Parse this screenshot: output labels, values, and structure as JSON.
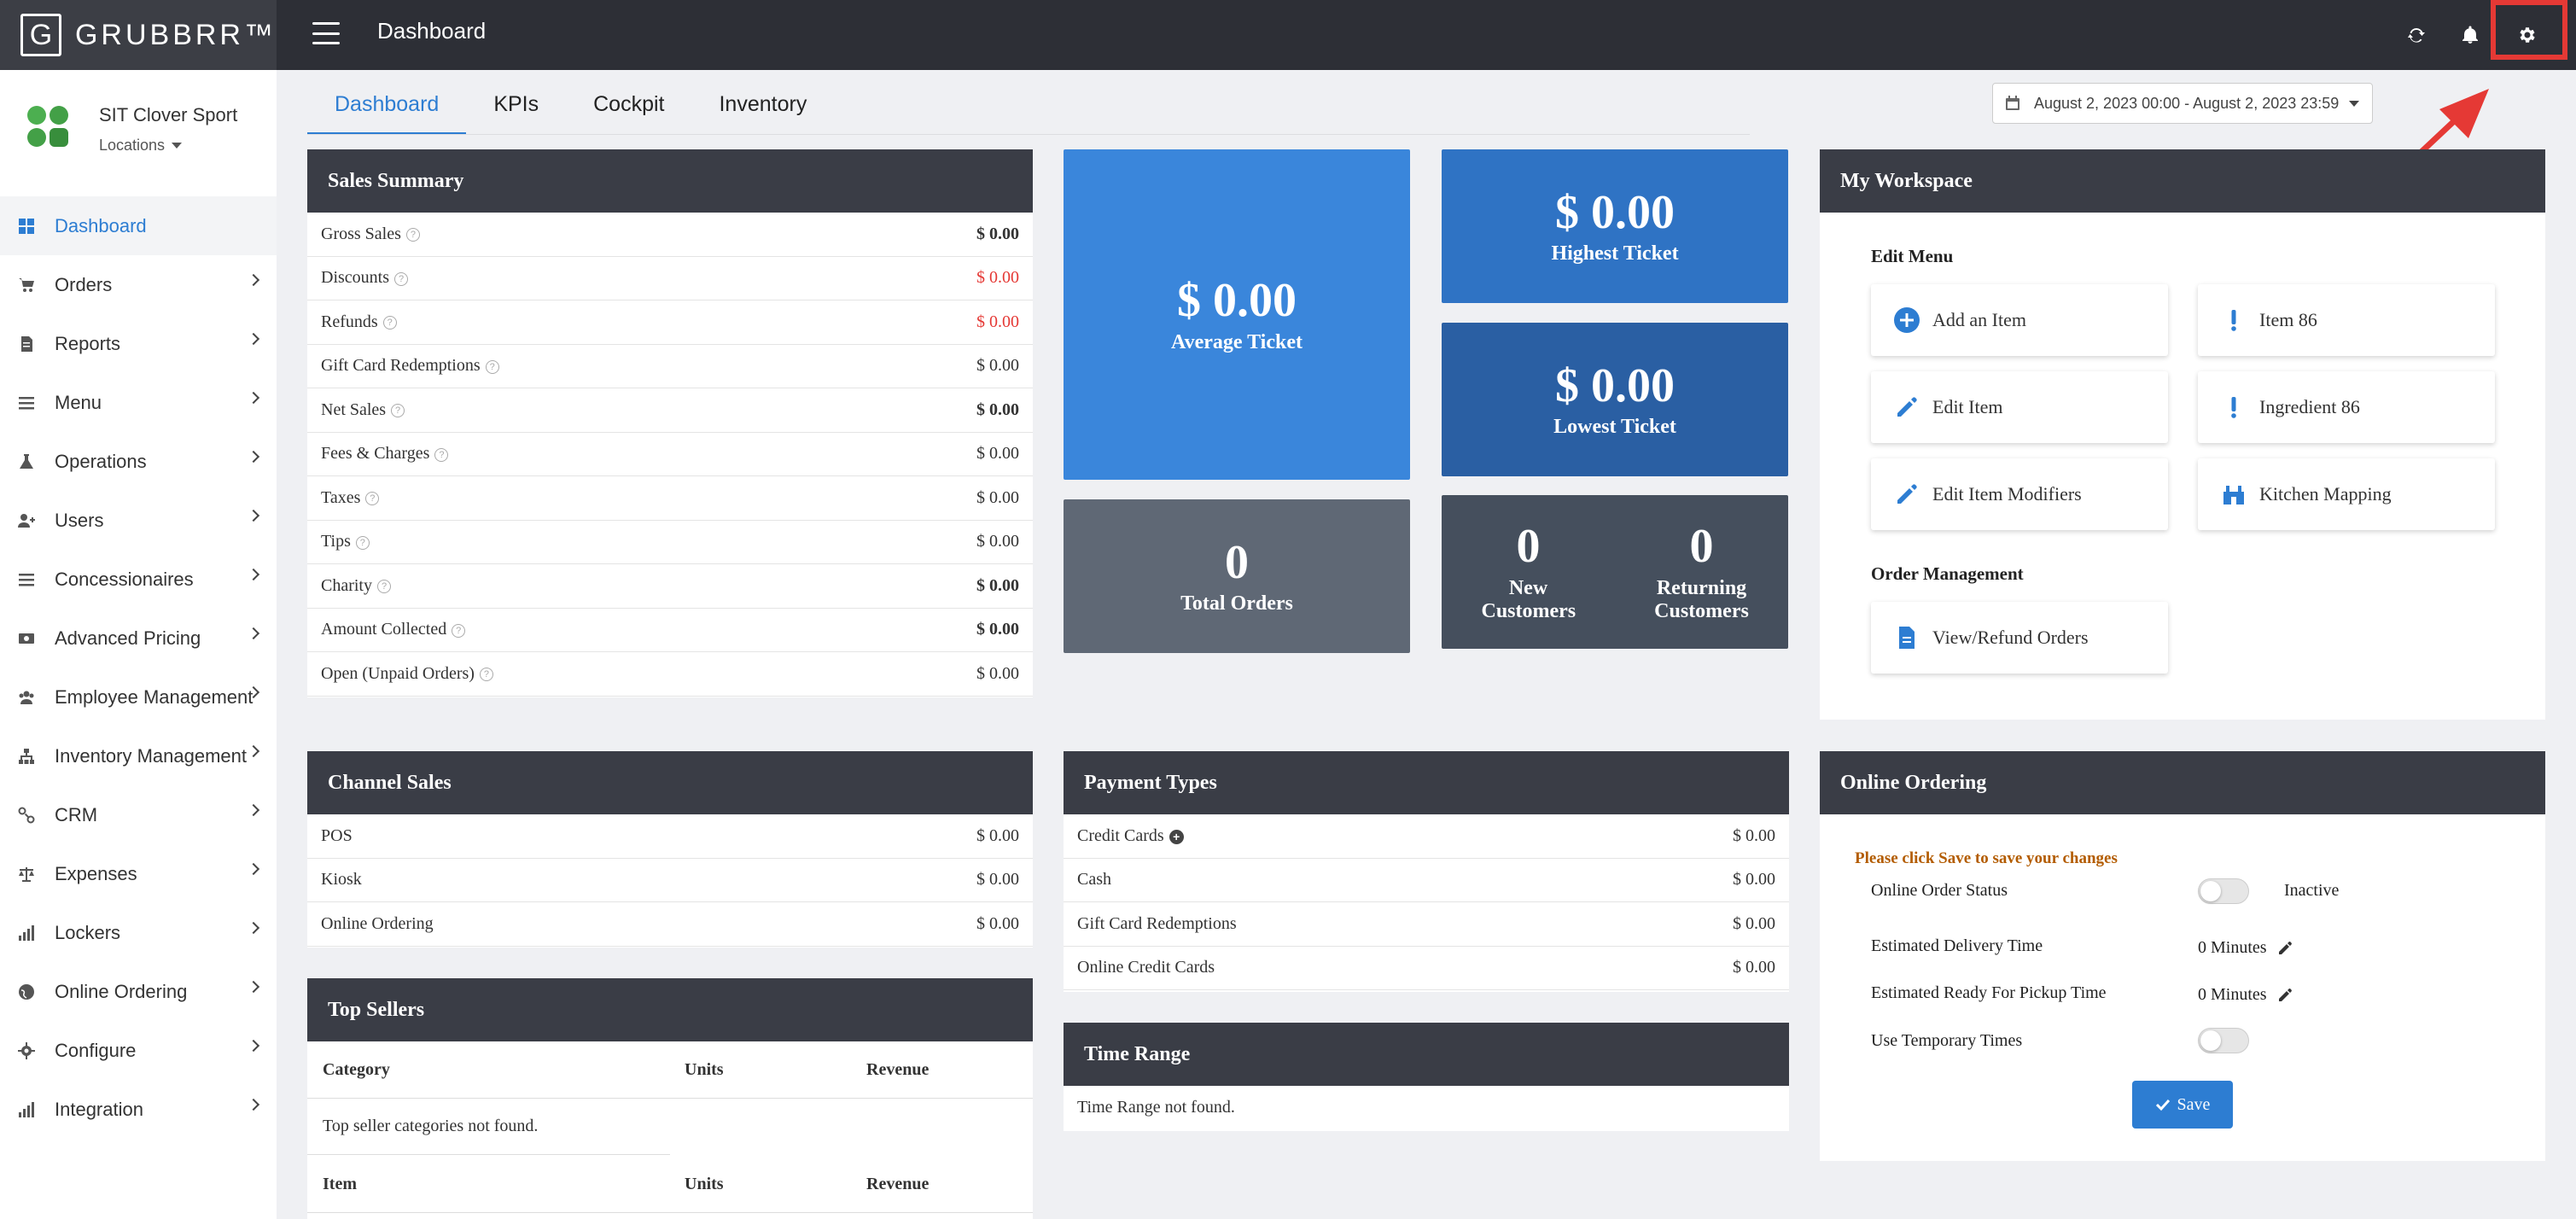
{
  "app": {
    "logo_letter": "G",
    "logo_text": "GRUBBRR™",
    "page_title": "Dashboard"
  },
  "topbar": {
    "icons": [
      "refresh-icon",
      "bell-icon",
      "gear-icon"
    ]
  },
  "store": {
    "name": "SIT Clover Sport",
    "locations_label": "Locations"
  },
  "sidebar": {
    "items": [
      {
        "label": "Dashboard",
        "icon": "dashboard-icon",
        "active": true
      },
      {
        "label": "Orders",
        "icon": "cart-icon"
      },
      {
        "label": "Reports",
        "icon": "report-icon"
      },
      {
        "label": "Menu",
        "icon": "menu-icon"
      },
      {
        "label": "Operations",
        "icon": "flask-icon"
      },
      {
        "label": "Users",
        "icon": "users-icon"
      },
      {
        "label": "Concessionaires",
        "icon": "list-icon"
      },
      {
        "label": "Advanced Pricing",
        "icon": "money-icon"
      },
      {
        "label": "Employee Management",
        "icon": "group-icon"
      },
      {
        "label": "Inventory Management",
        "icon": "sitemap-icon"
      },
      {
        "label": "CRM",
        "icon": "link-icon"
      },
      {
        "label": "Expenses",
        "icon": "scale-icon"
      },
      {
        "label": "Lockers",
        "icon": "signal-icon"
      },
      {
        "label": "Online Ordering",
        "icon": "globe-icon"
      },
      {
        "label": "Configure",
        "icon": "cog-icon"
      },
      {
        "label": "Integration",
        "icon": "signal-icon"
      }
    ]
  },
  "tabs": [
    {
      "label": "Dashboard",
      "active": true
    },
    {
      "label": "KPIs"
    },
    {
      "label": "Cockpit"
    },
    {
      "label": "Inventory"
    }
  ],
  "date_range": "August 2, 2023 00:00 - August 2, 2023 23:59",
  "sales_summary": {
    "title": "Sales Summary",
    "rows": [
      {
        "label": "Gross Sales",
        "value": "$ 0.00",
        "style": "bold"
      },
      {
        "label": "Discounts",
        "value": "$ 0.00",
        "style": "red"
      },
      {
        "label": "Refunds",
        "value": "$ 0.00",
        "style": "red"
      },
      {
        "label": "Gift Card Redemptions",
        "value": "$ 0.00",
        "style": ""
      },
      {
        "label": "Net Sales",
        "value": "$ 0.00",
        "style": "bold"
      },
      {
        "label": "Fees & Charges",
        "value": "$ 0.00",
        "style": ""
      },
      {
        "label": "Taxes",
        "value": "$ 0.00",
        "style": ""
      },
      {
        "label": "Tips",
        "value": "$ 0.00",
        "style": ""
      },
      {
        "label": "Charity",
        "value": "$ 0.00",
        "style": "bold"
      },
      {
        "label": "Amount Collected",
        "value": "$ 0.00",
        "style": "bold"
      },
      {
        "label": "Open (Unpaid Orders)",
        "value": "$ 0.00",
        "style": ""
      }
    ]
  },
  "kpis": {
    "average_ticket": {
      "value": "$ 0.00",
      "label": "Average Ticket"
    },
    "highest_ticket": {
      "value": "$ 0.00",
      "label": "Highest Ticket"
    },
    "lowest_ticket": {
      "value": "$ 0.00",
      "label": "Lowest Ticket"
    },
    "total_orders": {
      "value": "0",
      "label": "Total Orders"
    },
    "new_customers": {
      "value": "0",
      "label": "New Customers"
    },
    "returning_customers": {
      "value": "0",
      "label": "Returning Customers"
    }
  },
  "workspace": {
    "title": "My Workspace",
    "edit_menu_label": "Edit Menu",
    "order_mgmt_label": "Order Management",
    "buttons": {
      "add_item": "Add an Item",
      "item86": "Item 86",
      "edit_item": "Edit Item",
      "ingredient86": "Ingredient 86",
      "edit_modifiers": "Edit Item Modifiers",
      "kitchen_mapping": "Kitchen Mapping",
      "view_refund": "View/Refund Orders"
    }
  },
  "channel_sales": {
    "title": "Channel Sales",
    "rows": [
      {
        "label": "POS",
        "value": "$ 0.00"
      },
      {
        "label": "Kiosk",
        "value": "$ 0.00"
      },
      {
        "label": "Online Ordering",
        "value": "$ 0.00"
      }
    ]
  },
  "payment_types": {
    "title": "Payment Types",
    "rows": [
      {
        "label": "Credit Cards",
        "value": "$ 0.00"
      },
      {
        "label": "Cash",
        "value": "$ 0.00"
      },
      {
        "label": "Gift Card Redemptions",
        "value": "$ 0.00"
      },
      {
        "label": "Online Credit Cards",
        "value": "$ 0.00"
      }
    ]
  },
  "top_sellers": {
    "title": "Top Sellers",
    "headers": {
      "category": "Category",
      "units": "Units",
      "revenue": "Revenue",
      "item": "Item"
    },
    "empty_message": "Top seller categories not found."
  },
  "time_range": {
    "title": "Time Range",
    "empty_message": "Time Range not found."
  },
  "online_ordering": {
    "title": "Online Ordering",
    "notice": "Please click Save to save your changes",
    "status_label": "Online Order Status",
    "status_value": "Inactive",
    "delivery_label": "Estimated Delivery Time",
    "delivery_value": "0 Minutes",
    "pickup_label": "Estimated Ready For Pickup Time",
    "pickup_value": "0 Minutes",
    "temp_label": "Use Temporary Times",
    "save_label": "Save"
  },
  "colors": {
    "accent": "#2d7dd2",
    "annotation": "#e53935",
    "tile_blue_light": "#3a86db",
    "tile_blue": "#2f73c4",
    "tile_blue_dark": "#2a5fa3",
    "tile_gray": "#5f6875",
    "tile_slate": "#454f5d"
  }
}
